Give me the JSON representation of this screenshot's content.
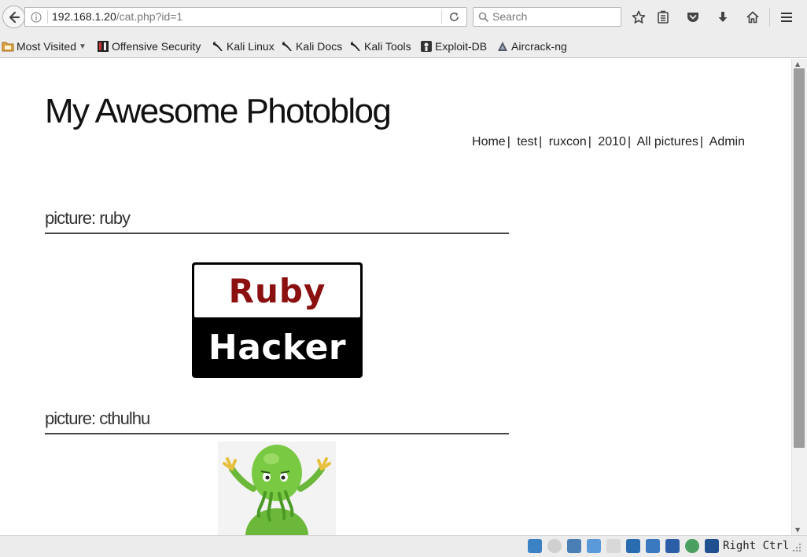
{
  "browser": {
    "url_host": "192.168.1.20",
    "url_path": "/cat.php?id=1",
    "search_placeholder": "Search"
  },
  "bookmarks": [
    {
      "label": "Most Visited",
      "icon": "folder-icon"
    },
    {
      "label": "Offensive Security",
      "icon": "offsec-icon"
    },
    {
      "label": "Kali Linux",
      "icon": "kali-dragon-icon"
    },
    {
      "label": "Kali Docs",
      "icon": "kali-dragon-icon"
    },
    {
      "label": "Kali Tools",
      "icon": "kali-dragon-icon"
    },
    {
      "label": "Exploit-DB",
      "icon": "exploitdb-icon"
    },
    {
      "label": "Aircrack-ng",
      "icon": "aircrack-icon"
    }
  ],
  "site": {
    "title": "My Awesome Photoblog",
    "nav": [
      "Home",
      "test",
      "ruxcon",
      "2010",
      "All pictures",
      "Admin"
    ]
  },
  "pictures": [
    {
      "heading": "picture: ruby",
      "image_top": "Ruby",
      "image_bottom": "Hacker"
    },
    {
      "heading": "picture: cthulhu"
    }
  ],
  "vm_status": {
    "host_key": "Right Ctrl"
  },
  "colors": {
    "ruby_red": "#8b1010",
    "cthulhu_green": "#7ac943"
  }
}
